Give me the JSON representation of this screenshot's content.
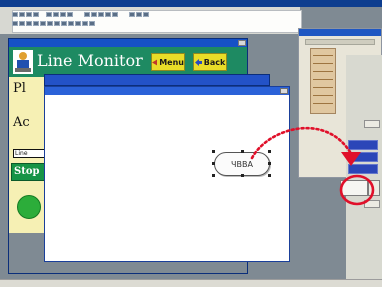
{
  "form": {
    "title": "Line Monitor",
    "menu_button_label": "Menu",
    "back_button_label": "Back",
    "label_pl": "Pl",
    "label_ac": "Ac",
    "line_button_label": "Line",
    "stop_button_label": "Stop"
  },
  "canvas": {
    "pill_text": "ЧВВА"
  },
  "colors": {
    "header_green": "#1e8a62",
    "button_yellow": "#e8dd28",
    "title_blue": "#1651c6",
    "annotation_red": "#e0102a",
    "panel_yellow": "#f6f0b4",
    "status_green": "#2cad3a"
  },
  "icons": {
    "app_icon": "person-at-computer-icon",
    "menu_icon": "left-triangle-icon",
    "back_icon": "left-arrow-icon",
    "close_icon": "window-close-icon",
    "annotation": "dotted-red-arrow-and-circle"
  }
}
